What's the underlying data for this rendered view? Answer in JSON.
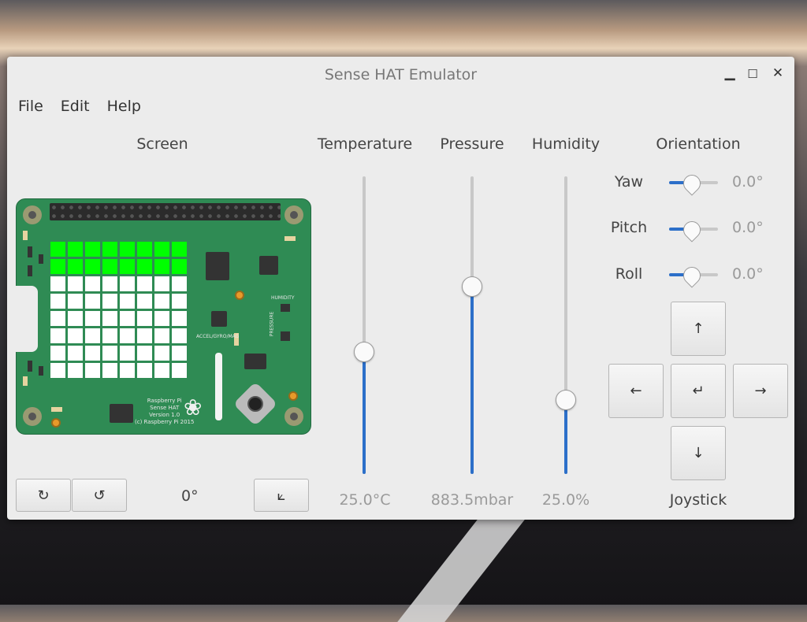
{
  "window": {
    "title": "Sense HAT Emulator"
  },
  "menu": {
    "file": "File",
    "edit": "Edit",
    "help": "Help"
  },
  "headers": {
    "screen": "Screen",
    "temperature": "Temperature",
    "pressure": "Pressure",
    "humidity": "Humidity",
    "orientation": "Orientation"
  },
  "board": {
    "label_humidity": "HUMIDITY",
    "label_pressure": "PRESSURE",
    "label_accel": "ACCEL/GYRO/MAG",
    "label_info": "Raspberry Pi\nSense HAT\nVersion 1.0\n(c) Raspberry Pi 2015",
    "lit_color": "#00ff00",
    "off_color": "#ffffff",
    "lit_rows": [
      0,
      1
    ]
  },
  "screen_controls": {
    "rotate_cw_icon": "↻",
    "rotate_ccw_icon": "↺",
    "rotation": "0°",
    "orientation_icon": "⟀"
  },
  "sliders": {
    "temperature": {
      "value": "25.0°C",
      "fraction": 0.41
    },
    "pressure": {
      "value": "883.5mbar",
      "fraction": 0.63
    },
    "humidity": {
      "value": "25.0%",
      "fraction": 0.25
    }
  },
  "orientation": {
    "yaw": {
      "label": "Yaw",
      "value": "0.0°"
    },
    "pitch": {
      "label": "Pitch",
      "value": "0.0°"
    },
    "roll": {
      "label": "Roll",
      "value": "0.0°"
    }
  },
  "joystick": {
    "label": "Joystick",
    "up": "↑",
    "down": "↓",
    "left": "←",
    "right": "→",
    "enter": "↵"
  },
  "colors": {
    "accent": "#2c6fc9",
    "board": "#2f8b54"
  }
}
